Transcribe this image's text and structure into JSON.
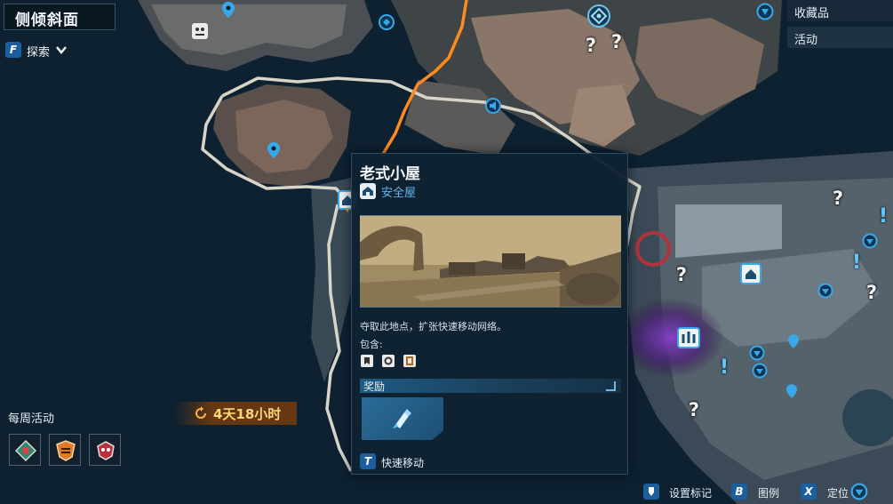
{
  "region": {
    "title": "侧倾斜面"
  },
  "filter": {
    "key": "F",
    "label": "探索"
  },
  "right_tabs": [
    "收藏品",
    "活动"
  ],
  "weekly": {
    "title": "每周活动",
    "timer": "4天18小时",
    "slots": [
      "activity-emblem-icon",
      "activity-crest-icon",
      "activity-skull-icon"
    ]
  },
  "popup": {
    "title": "老式小屋",
    "type_label": "安全屋",
    "type_icon": "safehouse-icon",
    "description": "夺取此地点，扩张快速移动网络。",
    "contains_label": "包含:",
    "contains_icons": [
      "loot-marker-icon",
      "safe-marker-icon",
      "scroll-marker-icon"
    ],
    "rewards_label": "奖励",
    "reward_icon": "fast-travel-pod-icon",
    "action_key": "T",
    "action_label": "快速移动"
  },
  "bottom_bar": [
    {
      "key": "",
      "label": "设置标记",
      "icon": "map-pin-icon"
    },
    {
      "key": "B",
      "label": "图例"
    },
    {
      "key": "X",
      "label": "定位"
    }
  ],
  "colors": {
    "accent": "#1c5f9e",
    "route": "#ff8a1e",
    "boundary": "#d9d4c8",
    "timer_bg": "#6e3a0e",
    "timer_text": "#ffd27a",
    "link_blue": "#5fb6f0",
    "purple_zone": "#6a2a9e"
  }
}
